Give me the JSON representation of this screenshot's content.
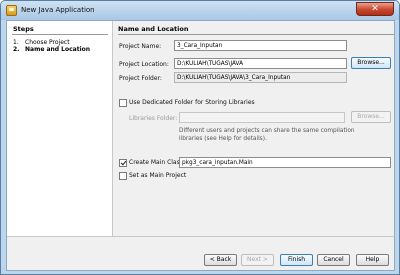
{
  "window": {
    "title": "New Java Application",
    "close_label": "✕"
  },
  "steps": {
    "title": "Steps",
    "items": [
      {
        "num": "1.",
        "label": "Choose Project"
      },
      {
        "num": "2.",
        "label": "Name and Location"
      }
    ]
  },
  "section": {
    "title": "Name and Location"
  },
  "form": {
    "project_name": {
      "label": "Project Name:",
      "value": "3_Cara_Inputan"
    },
    "project_location": {
      "label": "Project Location:",
      "value": "D:\\KULIAH\\TUGAS\\JAVA",
      "browse": "Browse..."
    },
    "project_folder": {
      "label": "Project Folder:",
      "value": "D:\\KULIAH\\TUGAS\\JAVA\\3_Cara_Inputan"
    },
    "dedicated_folder": {
      "label": "Use Dedicated Folder for Storing Libraries",
      "checked": false
    },
    "libraries_folder": {
      "label": "Libraries Folder:",
      "value": "",
      "browse": "Browse..."
    },
    "libraries_desc": "Different users and projects can share the same compilation libraries (see Help for details).",
    "main_class": {
      "label": "Create Main Class",
      "checked": true,
      "value": "pkg3_cara_inputan.Main"
    },
    "set_main": {
      "label": "Set as Main Project",
      "checked": false
    }
  },
  "buttons": {
    "back": "< Back",
    "next": "Next >",
    "finish": "Finish",
    "cancel": "Cancel",
    "help": "Help"
  }
}
